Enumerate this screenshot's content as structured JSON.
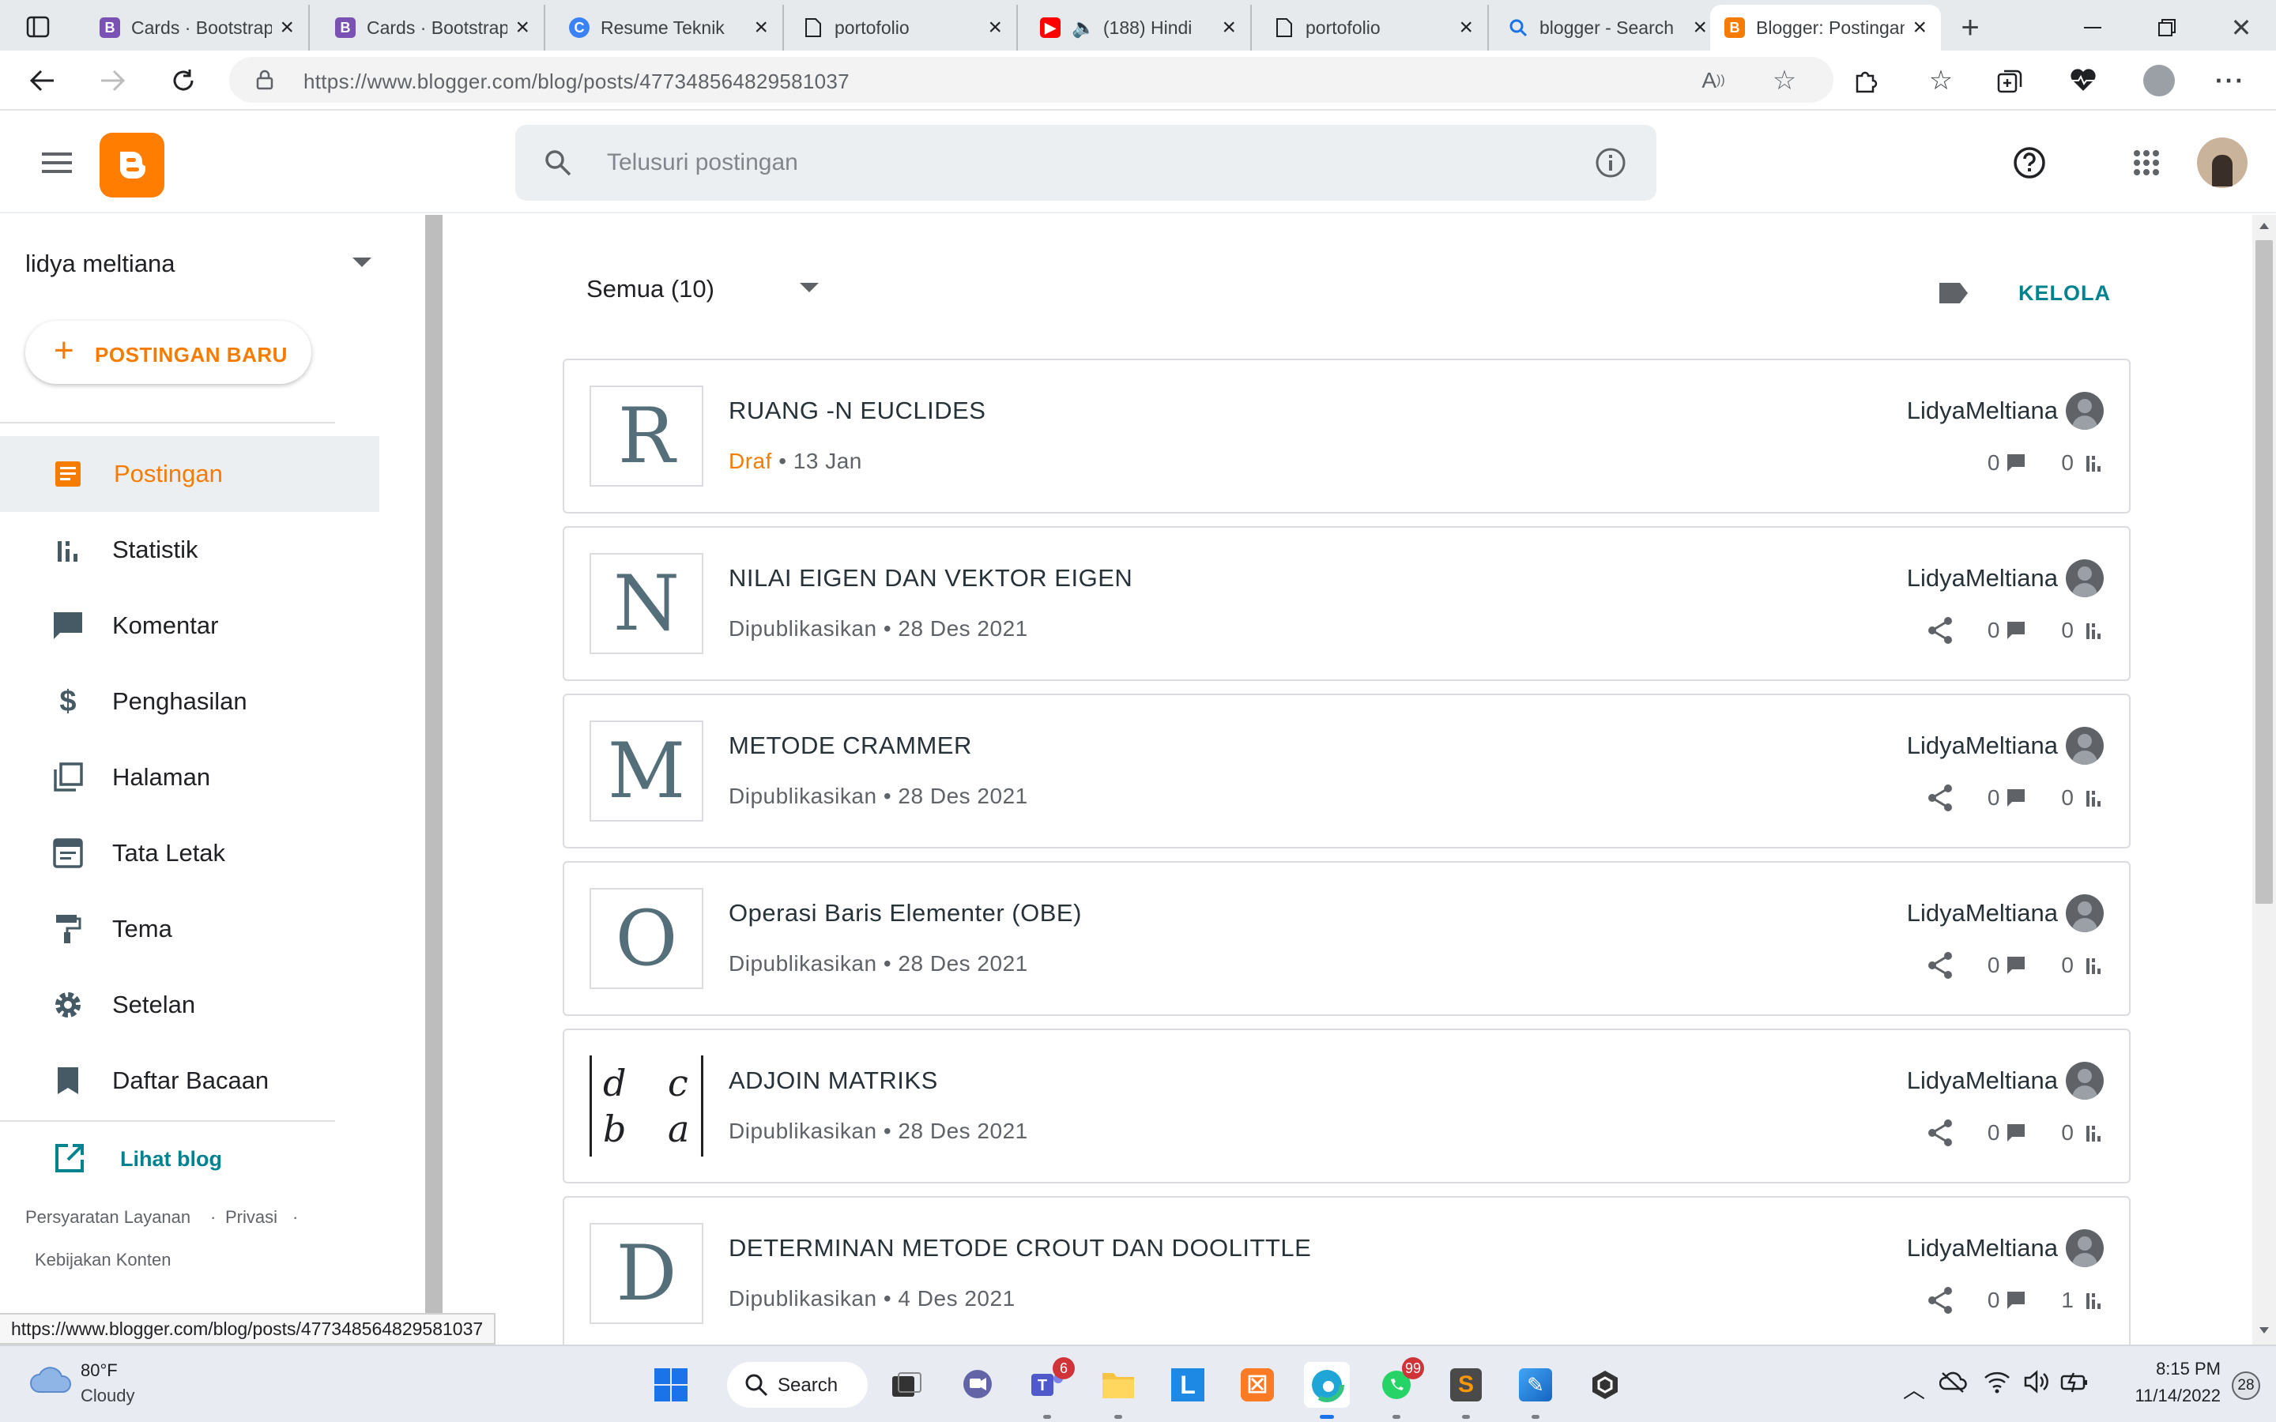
{
  "browser": {
    "tabs": [
      {
        "title": "Cards · Bootstrap",
        "icon": "bootstrap-icon",
        "color": "#7952b3"
      },
      {
        "title": "Cards · Bootstrap",
        "icon": "bootstrap-icon",
        "color": "#7952b3"
      },
      {
        "title": "Resume Teknik",
        "icon": "canva-icon",
        "color": "#3b82f6"
      },
      {
        "title": "portofolio",
        "icon": "page-icon",
        "color": "#5f6368"
      },
      {
        "title": "(188) Hindi",
        "icon": "youtube-icon",
        "color": "#ff0000"
      },
      {
        "title": "portofolio",
        "icon": "page-icon",
        "color": "#5f6368"
      },
      {
        "title": "blogger - Search",
        "icon": "search-icon",
        "color": "#1a73e8"
      },
      {
        "title": "Blogger: Postingan",
        "icon": "blogger-icon",
        "color": "#f57c00"
      }
    ],
    "url": "https://www.blogger.com/blog/posts/477348564829581037"
  },
  "blogger": {
    "search_placeholder": "Telusuri postingan"
  },
  "sidebar": {
    "blog_name": "lidya meltiana",
    "new_post": "POSTINGAN BARU",
    "items": [
      {
        "label": "Postingan",
        "icon": "posts-icon"
      },
      {
        "label": "Statistik",
        "icon": "stats-icon"
      },
      {
        "label": "Komentar",
        "icon": "comment-icon"
      },
      {
        "label": "Penghasilan",
        "icon": "dollar-icon"
      },
      {
        "label": "Halaman",
        "icon": "pages-icon"
      },
      {
        "label": "Tata Letak",
        "icon": "layout-icon"
      },
      {
        "label": "Tema",
        "icon": "paint-roller-icon"
      },
      {
        "label": "Setelan",
        "icon": "gear-icon"
      },
      {
        "label": "Daftar Bacaan",
        "icon": "bookmark-icon"
      }
    ],
    "view_blog": "Lihat blog",
    "footer": {
      "terms": "Persyaratan Layanan",
      "sep": "·",
      "privacy": "Privasi",
      "content_policy": "Kebijakan Konten"
    }
  },
  "main": {
    "filter": "Semua (10)",
    "manage": "KELOLA",
    "posts": [
      {
        "thumb": "R",
        "title": "RUANG -N EUCLIDES",
        "status": "Draf",
        "date": "13 Jan",
        "author": "LidyaMeltiana",
        "comments": "0",
        "views": "0",
        "draft": true
      },
      {
        "thumb": "N",
        "title": "NILAI EIGEN DAN VEKTOR EIGEN",
        "status": "Dipublikasikan",
        "date": "28 Des 2021",
        "author": "LidyaMeltiana",
        "comments": "0",
        "views": "0",
        "draft": false
      },
      {
        "thumb": "M",
        "title": "METODE CRAMMER",
        "status": "Dipublikasikan",
        "date": "28 Des 2021",
        "author": "LidyaMeltiana",
        "comments": "0",
        "views": "0",
        "draft": false
      },
      {
        "thumb": "O",
        "title": "Operasi Baris Elementer (OBE)",
        "status": "Dipublikasikan",
        "date": "28 Des 2021",
        "author": "LidyaMeltiana",
        "comments": "0",
        "views": "0",
        "draft": false
      },
      {
        "thumb": "matrix",
        "matrix": [
          "d",
          "c",
          "b",
          "a"
        ],
        "title": "ADJOIN MATRIKS",
        "status": "Dipublikasikan",
        "date": "28 Des 2021",
        "author": "LidyaMeltiana",
        "comments": "0",
        "views": "0",
        "draft": false
      },
      {
        "thumb": "D",
        "title": "DETERMINAN METODE CROUT DAN DOOLITTLE",
        "status": "Dipublikasikan",
        "date": "4 Des 2021",
        "author": "LidyaMeltiana",
        "comments": "0",
        "views": "1",
        "draft": false
      }
    ],
    "meta_sep": "•"
  },
  "status_url": "https://www.blogger.com/blog/posts/477348564829581037",
  "taskbar": {
    "weather_temp": "80°F",
    "weather_desc": "Cloudy",
    "search_label": "Search",
    "teams_badge": "6",
    "whatsapp_badge": "99",
    "time": "8:15 PM",
    "date": "11/14/2022",
    "notif_count": "28"
  },
  "colors": {
    "accent": "#f57c00",
    "link": "#00838f"
  }
}
